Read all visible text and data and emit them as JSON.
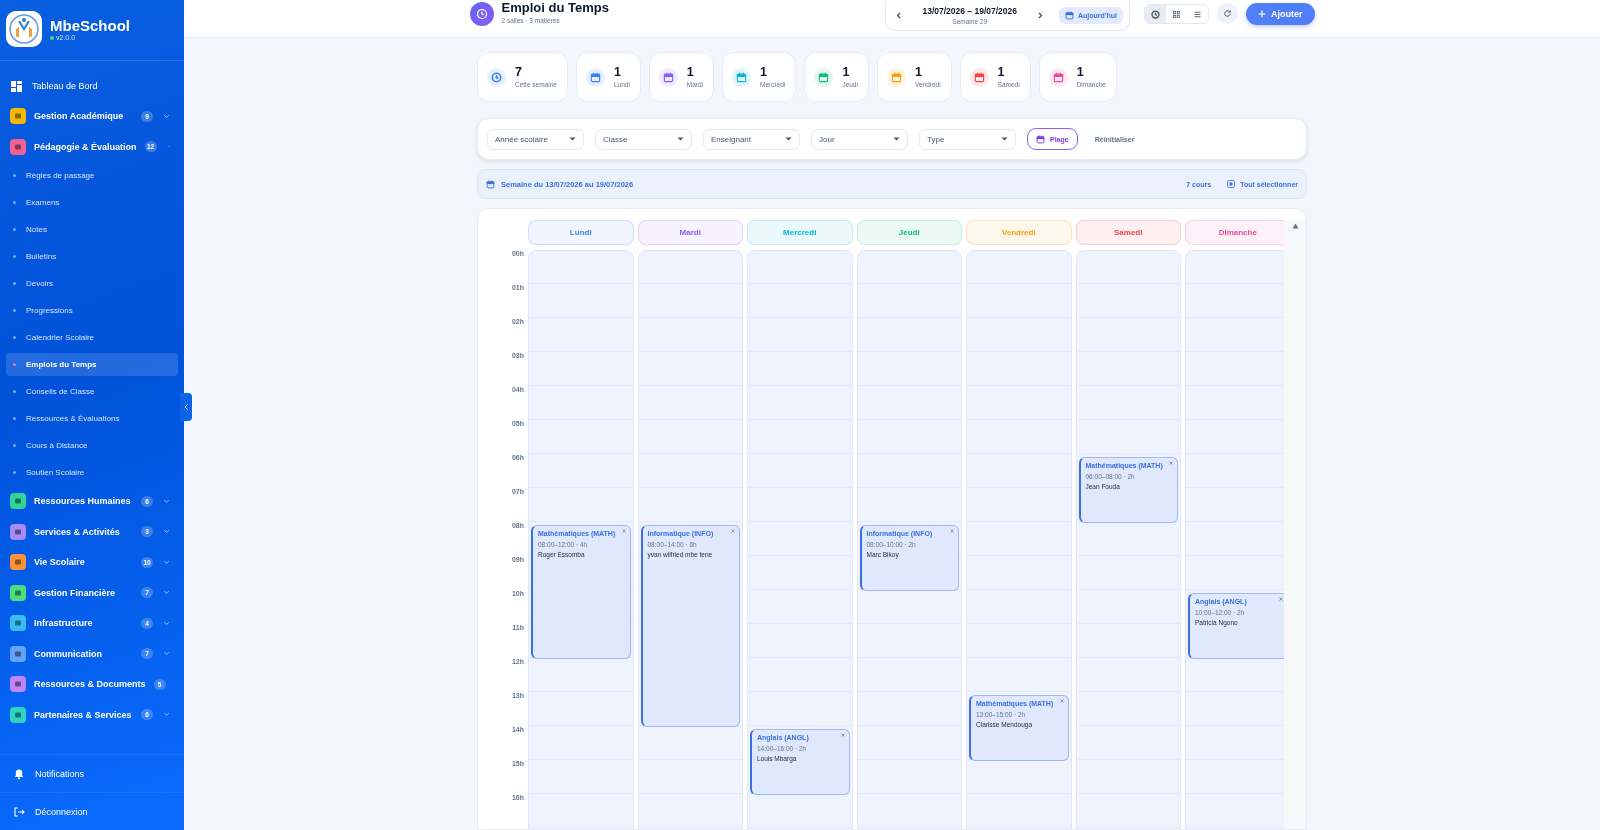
{
  "sidebar": {
    "brand": "MbeSchool",
    "version": "v2.0.0",
    "items": [
      {
        "kind": "link",
        "label": "Tableau de Bord"
      },
      {
        "kind": "group",
        "label": "Gestion Académique",
        "color": "#f5b800",
        "badge": "9",
        "expanded": false
      },
      {
        "kind": "group",
        "label": "Pédagogie & Évaluation",
        "color": "#f06292",
        "badge": "12",
        "expanded": true,
        "children": [
          {
            "label": "Règles de passage",
            "selected": false
          },
          {
            "label": "Examens",
            "selected": false
          },
          {
            "label": "Notes",
            "selected": false
          },
          {
            "label": "Bulletins",
            "selected": false
          },
          {
            "label": "Devoirs",
            "selected": false
          },
          {
            "label": "Progressions",
            "selected": false
          },
          {
            "label": "Calendrier Scolaire",
            "selected": false
          },
          {
            "label": "Emplois du Temps",
            "selected": true
          },
          {
            "label": "Conseils de Classe",
            "selected": false
          },
          {
            "label": "Ressources & Évaluations",
            "selected": false
          },
          {
            "label": "Cours à Distance",
            "selected": false
          },
          {
            "label": "Soutien Scolaire",
            "selected": false
          }
        ]
      },
      {
        "kind": "group",
        "label": "Ressources Humaines",
        "color": "#34d399",
        "badge": "6",
        "expanded": false
      },
      {
        "kind": "group",
        "label": "Services & Activités",
        "color": "#a78bfa",
        "badge": "3",
        "expanded": false
      },
      {
        "kind": "group",
        "label": "Vie Scolaire",
        "color": "#fb923c",
        "badge": "10",
        "expanded": false
      },
      {
        "kind": "group",
        "label": "Gestion Financière",
        "color": "#4ade80",
        "badge": "7",
        "expanded": false
      },
      {
        "kind": "group",
        "label": "Infrastructure",
        "color": "#38bdf8",
        "badge": "4",
        "expanded": false
      },
      {
        "kind": "group",
        "label": "Communication",
        "color": "#60a5fa",
        "badge": "7",
        "expanded": false
      },
      {
        "kind": "group",
        "label": "Ressources & Documents",
        "color": "#c084fc",
        "badge": "5",
        "expanded": false
      },
      {
        "kind": "group",
        "label": "Partenaires & Services",
        "color": "#2dd4bf",
        "badge": "6",
        "expanded": false
      }
    ],
    "footer": [
      {
        "kind": "notifications",
        "label": "Notifications"
      },
      {
        "kind": "logout",
        "label": "Déconnexion"
      }
    ]
  },
  "header": {
    "title": "Emploi du Temps",
    "subtitle": "2 salles · 3 matières",
    "range": "13/07/2026 – 19/07/2026",
    "week": "Semaine 29",
    "today": "Aujourd'hui",
    "views": [
      {
        "kind": "clock",
        "selected": true
      },
      {
        "kind": "grid",
        "selected": false
      },
      {
        "kind": "list",
        "selected": false
      }
    ],
    "add": "Ajouter"
  },
  "stats": [
    {
      "kind": "clock",
      "value": "7",
      "label": "Cette semaine",
      "color": "#3b82f6"
    },
    {
      "kind": "calendar",
      "value": "1",
      "label": "Lundi",
      "color": "#3b82f6"
    },
    {
      "kind": "calendar",
      "value": "1",
      "label": "Mardi",
      "color": "#8b5cf6"
    },
    {
      "kind": "calendar",
      "value": "1",
      "label": "Mercredi",
      "color": "#06b6d4"
    },
    {
      "kind": "calendar",
      "value": "1",
      "label": "Jeudi",
      "color": "#10b981"
    },
    {
      "kind": "calendar",
      "value": "1",
      "label": "Vendredi",
      "color": "#f59e0b"
    },
    {
      "kind": "calendar",
      "value": "1",
      "label": "Samedi",
      "color": "#ef4444"
    },
    {
      "kind": "calendar",
      "value": "1",
      "label": "Dimanche",
      "color": "#ec4899"
    }
  ],
  "filters": {
    "selects": [
      {
        "label": "Année scolaire"
      },
      {
        "label": "Classe"
      },
      {
        "label": "Enseignant"
      },
      {
        "label": "Jour"
      },
      {
        "label": "Type"
      }
    ],
    "range_button": "Plage",
    "reset": "Réinitialiser"
  },
  "week_bar": {
    "label": "Semaine du 13/07/2026 au 19/07/2026",
    "count": "7 cours",
    "select_all": "Tout sélectionner"
  },
  "calendar": {
    "hours": [
      "00h",
      "01h",
      "02h",
      "03h",
      "04h",
      "05h",
      "06h",
      "07h",
      "08h",
      "09h",
      "10h",
      "11h",
      "12h",
      "13h",
      "14h",
      "15h",
      "16h"
    ],
    "days": [
      {
        "name": "Lundi",
        "color": "#3b82f6",
        "events": [
          {
            "title": "Mathématiques (MATH)",
            "time": "08:00–12:00 · 4h",
            "teacher": "Roger Essomba"
          }
        ]
      },
      {
        "name": "Mardi",
        "color": "#8b5cf6",
        "events": [
          {
            "title": "Informatique (INFO)",
            "time": "08:00–14:00 · 6h",
            "teacher": "yvan wilfried mbe tene"
          }
        ]
      },
      {
        "name": "Mercredi",
        "color": "#06b6d4",
        "events": [
          {
            "title": "Anglais (ANGL)",
            "time": "14:00–16:00 · 2h",
            "teacher": "Louis Mbarga"
          }
        ]
      },
      {
        "name": "Jeudi",
        "color": "#10b981",
        "events": [
          {
            "title": "Informatique (INFO)",
            "time": "08:00–10:00 · 2h",
            "teacher": "Marc Bikoy"
          }
        ]
      },
      {
        "name": "Vendredi",
        "color": "#f59e0b",
        "events": [
          {
            "title": "Mathématiques (MATH)",
            "time": "13:00–15:00 · 2h",
            "teacher": "Clarisse Mendouga"
          }
        ]
      },
      {
        "name": "Samedi",
        "color": "#ef4444",
        "events": [
          {
            "title": "Mathématiques (MATH)",
            "time": "06:00–08:00 · 2h",
            "teacher": "Jean Fouda"
          }
        ]
      },
      {
        "name": "Dimanche",
        "color": "#ec4899",
        "events": [
          {
            "title": "Anglais (ANGL)",
            "time": "10:00–12:00 · 2h",
            "teacher": "Patricia Ngono"
          }
        ]
      }
    ]
  }
}
